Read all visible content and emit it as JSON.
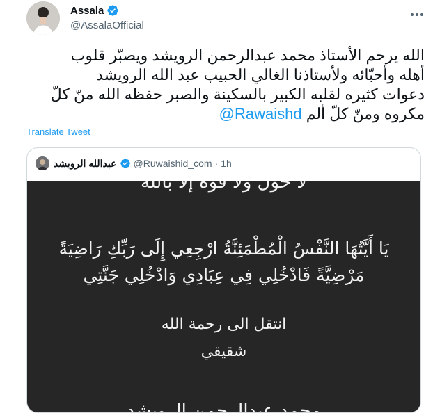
{
  "tweet": {
    "author_name": "Assala",
    "author_handle": "@AssalaOfficial",
    "lines": [
      "الله يرحم الأستاذ محمد عبدالرحمن الرويشد ويصبّر قلوب",
      "أهله وأحبّائه ولأستاذنا الغالي الحبيب عبد الله الرويشد",
      "دعوات كثيره لقلبه الكبير بالسكينة والصبر حفظه الله منّ كلّ",
      "مكروه  ومنّ كلّ ألم"
    ],
    "mention": "@Rawaishd",
    "translate_label": "Translate Tweet"
  },
  "quote": {
    "author_name": "عبدالله الرويشد",
    "author_handle": "@Ruwaishid_com",
    "separator": "·",
    "time": "1h",
    "image_text": {
      "top_partial": "لا حول ولا قوة إلا بالله",
      "verse_line1": "يَا أَيَّتُهَا النَّفْسُ الْمُطْمَئِنَّةُ ارْجِعِي إِلَى رَبِّكِ رَاضِيَةً",
      "verse_line2": "مَرْضِيَّةً فَادْخُلِي فِي عِبَادِي وَادْخُلِي جَنَّتِي",
      "transferred": "انتقل الى رحمة الله",
      "relation": "شقيقي",
      "bottom_partial": "محمد عبدالرحمن الرويشد"
    }
  },
  "colors": {
    "accent": "#1d9bf0",
    "text": "#0f1419",
    "muted": "#536471",
    "image_bg": "#262626"
  },
  "icons": [
    "verified-badge-icon",
    "more-options-icon"
  ]
}
